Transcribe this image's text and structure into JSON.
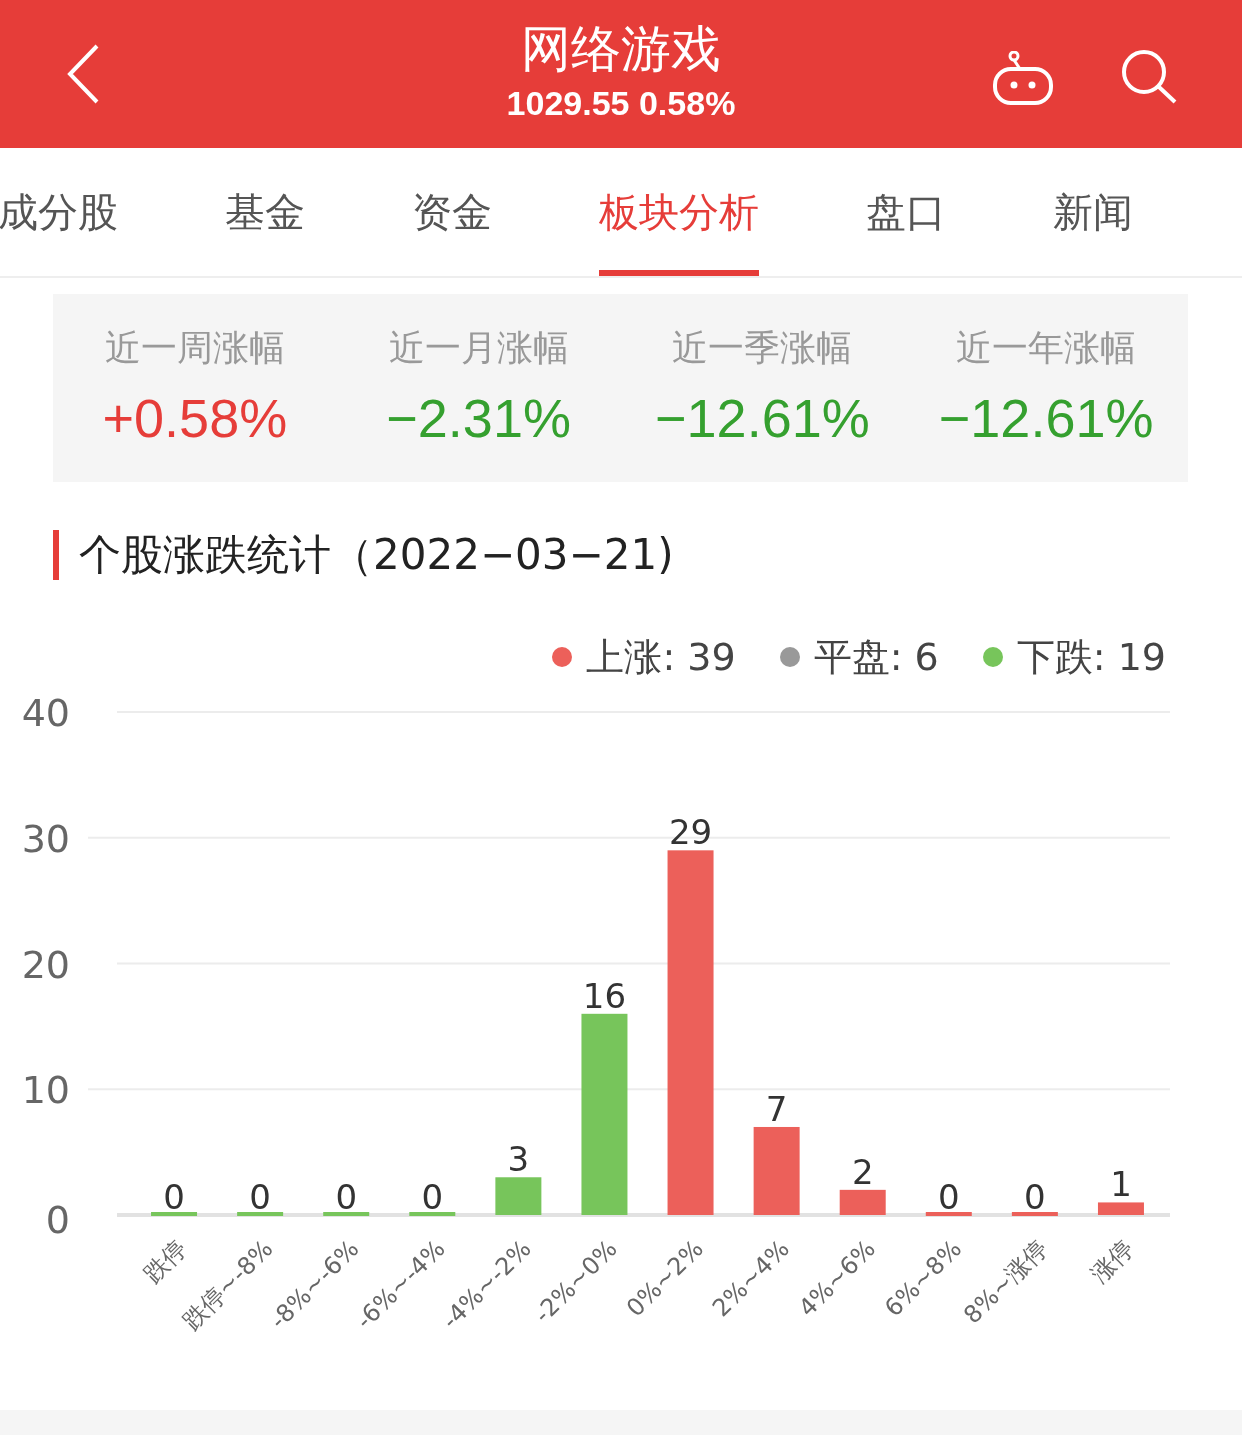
{
  "header": {
    "title": "网络游戏",
    "subtitle": "1029.55 0.58%"
  },
  "tabs": [
    {
      "label": "成分股",
      "selected": false
    },
    {
      "label": "基金",
      "selected": false
    },
    {
      "label": "资金",
      "selected": false
    },
    {
      "label": "板块分析",
      "selected": true
    },
    {
      "label": "盘口",
      "selected": false
    },
    {
      "label": "新闻",
      "selected": false
    }
  ],
  "period_changes": [
    {
      "label": "近一周涨幅",
      "value": "+0.58%",
      "color": "#e63d39"
    },
    {
      "label": "近一月涨幅",
      "value": "−2.31%",
      "color": "#35a02f"
    },
    {
      "label": "近一季涨幅",
      "value": "−12.61%",
      "color": "#35a02f"
    },
    {
      "label": "近一年涨幅",
      "value": "−12.61%",
      "color": "#35a02f"
    }
  ],
  "section_title": "个股涨跌统计（2022−03−21)",
  "legend": [
    {
      "label": "上涨: 39",
      "color": "#ec605a"
    },
    {
      "label": "平盘: 6",
      "color": "#999999"
    },
    {
      "label": "下跌: 19",
      "color": "#77c55b"
    }
  ],
  "chart_data": {
    "type": "bar",
    "categories": [
      "跌停",
      "跌停~-8%",
      "-8%~-6%",
      "-6%~-4%",
      "-4%~-2%",
      "-2%~0%",
      "0%~2%",
      "2%~4%",
      "4%~6%",
      "6%~8%",
      "8%~涨停",
      "涨停"
    ],
    "series": [
      {
        "color": "#77c55b",
        "values": [
          0,
          0,
          0,
          0,
          3,
          16,
          null,
          null,
          null,
          null,
          null,
          null
        ]
      },
      {
        "color": "#ec605a",
        "values": [
          null,
          null,
          null,
          null,
          null,
          null,
          29,
          7,
          2,
          0,
          0,
          1
        ]
      }
    ],
    "stacked": true,
    "grid": true,
    "ylim": [
      0,
      40
    ],
    "yticks": [
      0,
      10,
      20,
      30,
      40
    ],
    "data_labels": true
  }
}
